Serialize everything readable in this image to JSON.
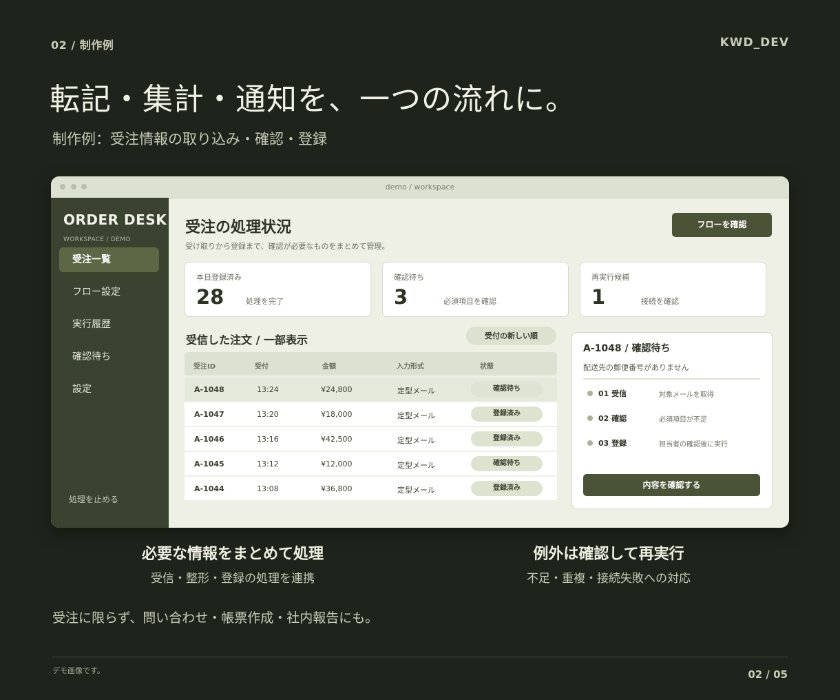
{
  "slide": {
    "label": "02 / 制作例",
    "brand": "KWD_DEV",
    "headline": "転記・集計・通知を、一つの流れに。",
    "subhead": "制作例：受注情報の取り込み・確認・登録",
    "features": [
      {
        "title": "必要な情報をまとめて処理",
        "sub": "受信・整形・登録の処理を連携"
      },
      {
        "title": "例外は確認して再実行",
        "sub": "不足・重複・接続失敗への対応"
      }
    ],
    "bottom_line": "受注に限らず、問い合わせ・帳票作成・社内報告にも。",
    "footnote": "デモ画像です。",
    "page": "02 / 05"
  },
  "window": {
    "title": "demo / workspace"
  },
  "sidebar": {
    "title": "ORDER DESK",
    "subtitle": "WORKSPACE / DEMO",
    "items": [
      {
        "label": "受注一覧",
        "active": true
      },
      {
        "label": "フロー設定"
      },
      {
        "label": "実行履歴"
      },
      {
        "label": "確認待ち"
      },
      {
        "label": "設定"
      }
    ],
    "stop_label": "処理を止める"
  },
  "main": {
    "title": "受注の処理状況",
    "description": "受け取りから登録まで、確認が必要なものをまとめて管理。",
    "flow_button": "フローを確認",
    "cards": [
      {
        "label": "本日登録済み",
        "value": "28",
        "note": "処理を完了"
      },
      {
        "label": "確認待ち",
        "value": "3",
        "note": "必須項目を確認"
      },
      {
        "label": "再実行候補",
        "value": "1",
        "note": "接続を確認"
      }
    ],
    "list_title": "受信した注文 / 一部表示",
    "sort_button": "受付の新しい順",
    "columns": [
      "受注ID",
      "受付",
      "金額",
      "入力形式",
      "状態"
    ],
    "rows": [
      {
        "id": "A-1048",
        "time": "13:24",
        "amount": "¥24,800",
        "format": "定型メール",
        "status": "確認待ち"
      },
      {
        "id": "A-1047",
        "time": "13:20",
        "amount": "¥18,000",
        "format": "定型メール",
        "status": "登録済み"
      },
      {
        "id": "A-1046",
        "time": "13:16",
        "amount": "¥42,500",
        "format": "定型メール",
        "status": "登録済み"
      },
      {
        "id": "A-1045",
        "time": "13:12",
        "amount": "¥12,000",
        "format": "定型メール",
        "status": "確認待ち"
      },
      {
        "id": "A-1044",
        "time": "13:08",
        "amount": "¥36,800",
        "format": "定型メール",
        "status": "登録済み"
      }
    ]
  },
  "detail": {
    "title": "A-1048 / 確認待ち",
    "description": "配送先の郵便番号がありません",
    "steps": [
      {
        "name": "01 受信",
        "note": "対象メールを取得"
      },
      {
        "name": "02 確認",
        "note": "必須項目が不足"
      },
      {
        "name": "03 登録",
        "note": "担当者の確認後に実行"
      }
    ],
    "button": "内容を確認する"
  },
  "colors": {
    "background": "#1e241b",
    "sidebar": "#3a4230",
    "accent": "#4a5336",
    "panel": "#eef0e6"
  }
}
